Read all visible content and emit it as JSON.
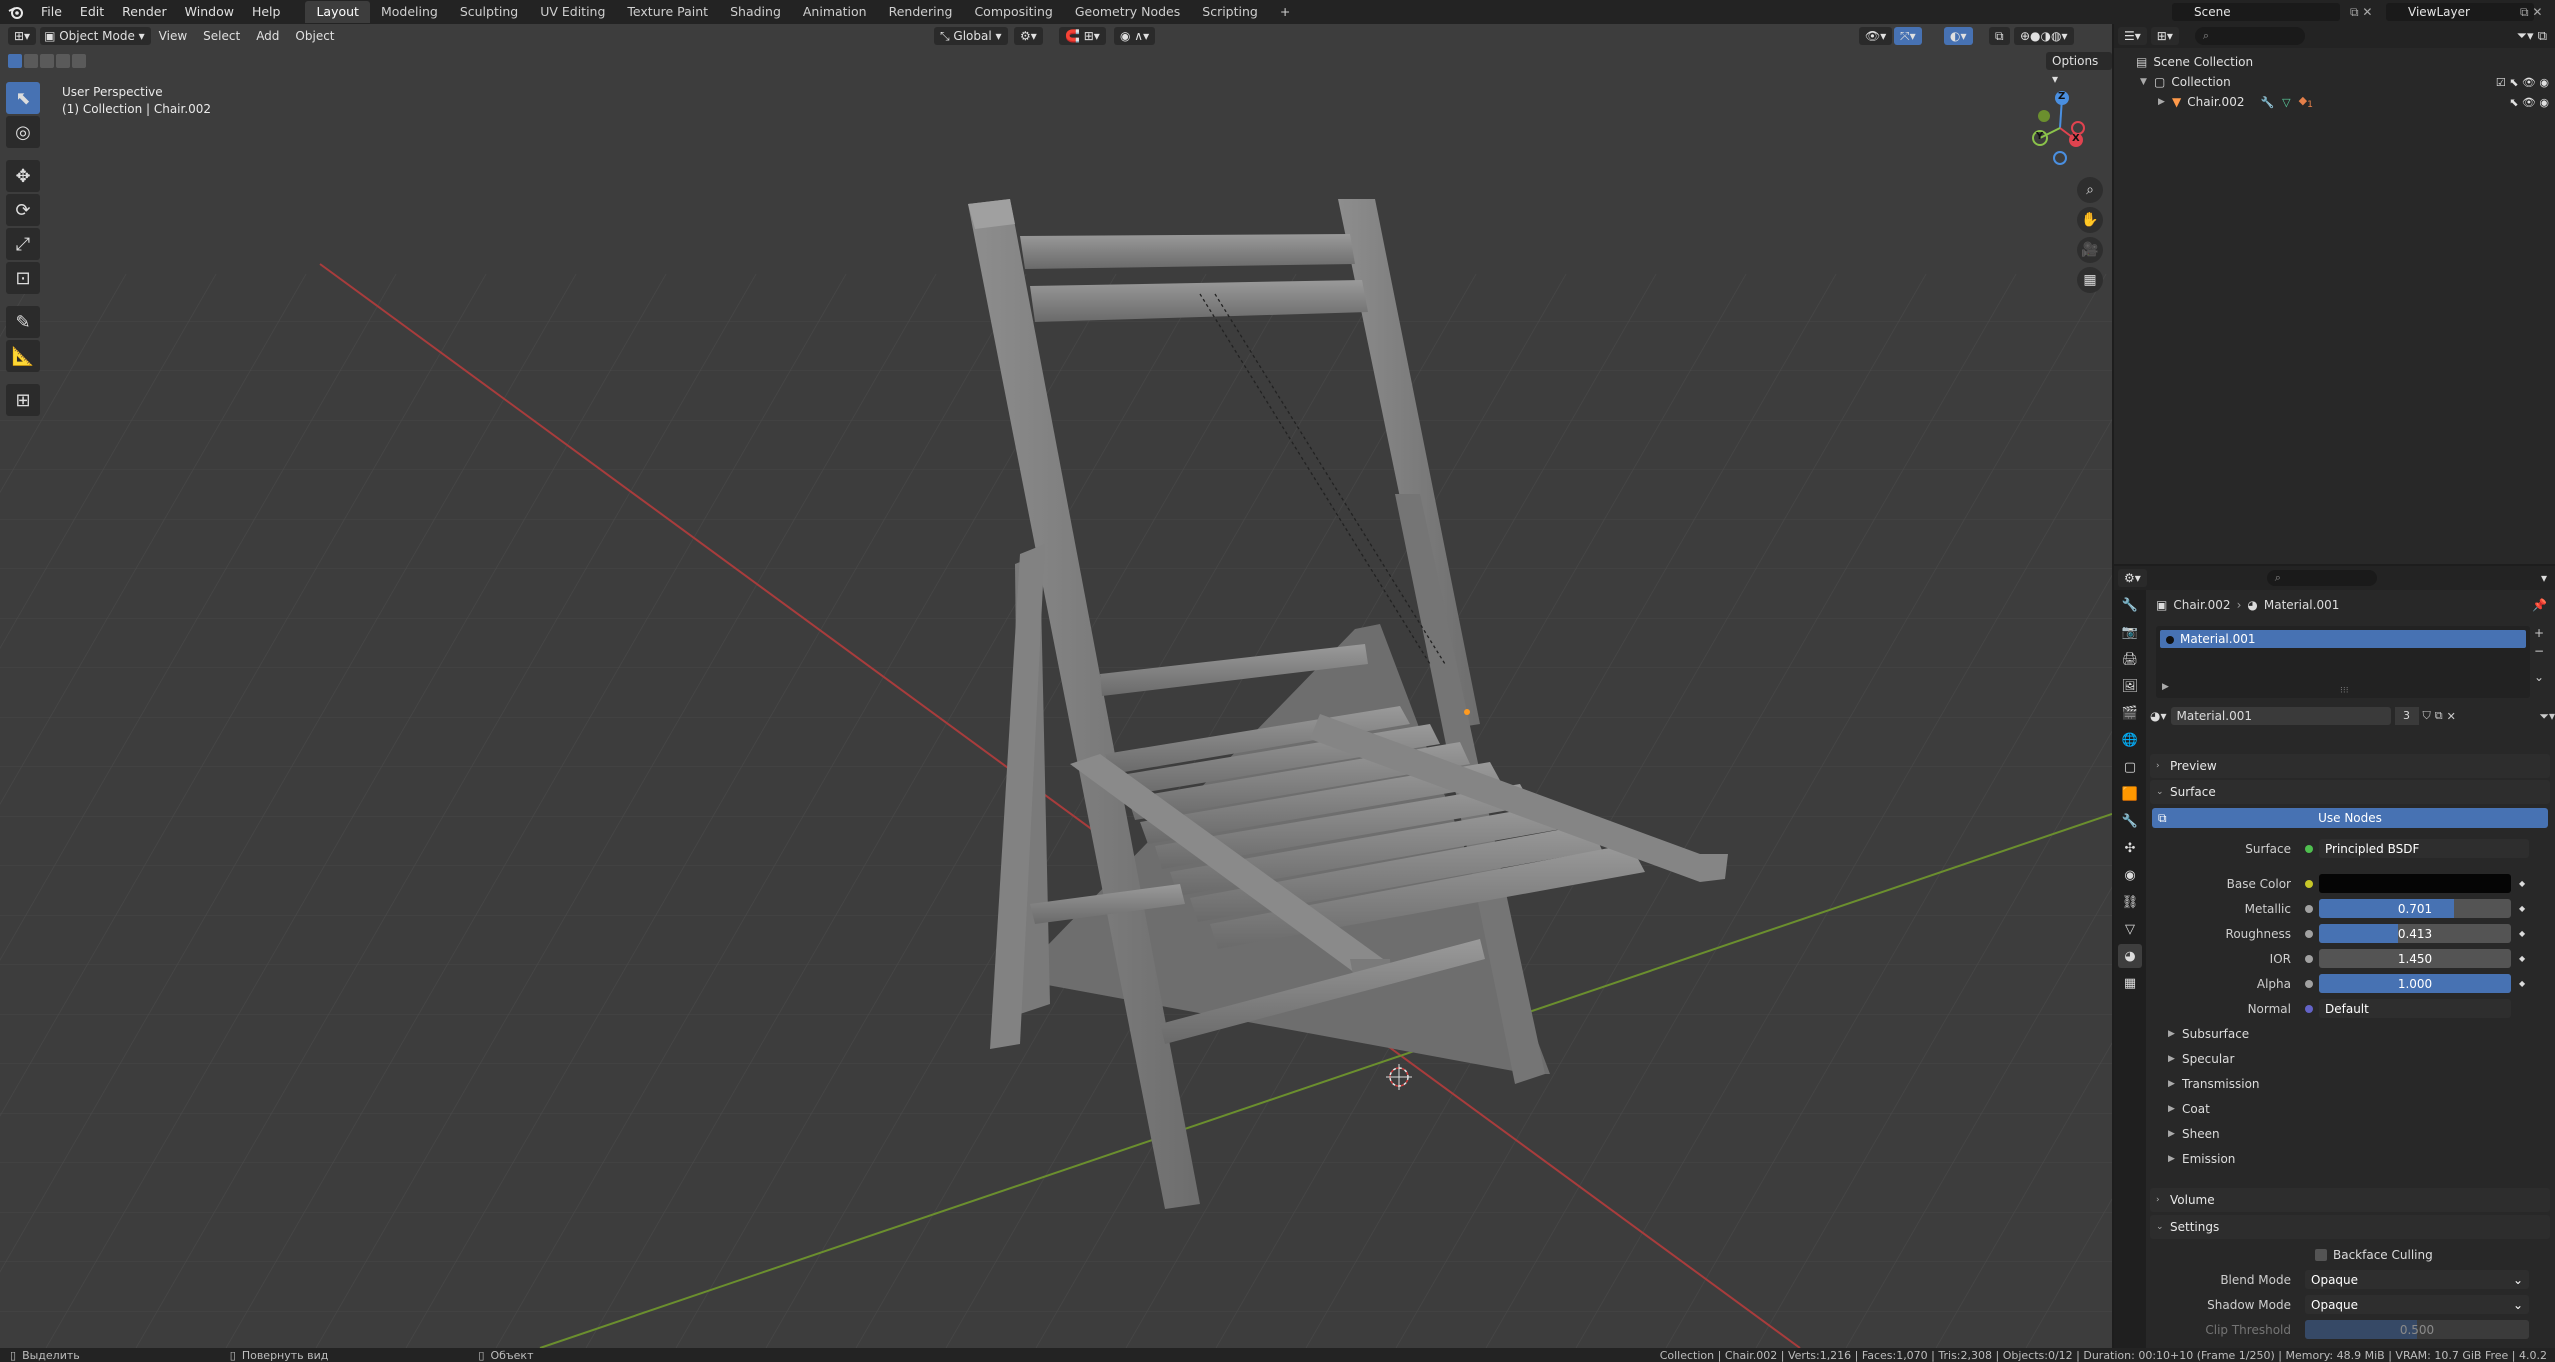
{
  "menu": {
    "file": "File",
    "edit": "Edit",
    "render": "Render",
    "window": "Window",
    "help": "Help"
  },
  "workspaces": [
    "Layout",
    "Modeling",
    "Sculpting",
    "UV Editing",
    "Texture Paint",
    "Shading",
    "Animation",
    "Rendering",
    "Compositing",
    "Geometry Nodes",
    "Scripting"
  ],
  "add_tab": "+",
  "scene": "Scene",
  "view_layer": "ViewLayer",
  "viewport": {
    "mode": "Object Mode",
    "menus": {
      "view": "View",
      "select": "Select",
      "add": "Add",
      "object": "Object"
    },
    "transform": "Global",
    "options": "Options",
    "info_line1": "User Perspective",
    "info_line2": "(1) Collection | Chair.002",
    "gizmo": {
      "z": "Z",
      "x": "X",
      "y": "Y"
    }
  },
  "outliner": {
    "scene_collection": "Scene Collection",
    "collection": "Collection",
    "object": "Chair.002",
    "modifier_count": "1"
  },
  "properties": {
    "breadcrumb_object": "Chair.002",
    "breadcrumb_material": "Material.001",
    "slot_name": "Material.001",
    "material_name": "Material.001",
    "user_count": "3",
    "sections": {
      "preview": "Preview",
      "surface": "Surface",
      "volume": "Volume",
      "settings": "Settings"
    },
    "use_nodes": "Use Nodes",
    "surface_label": "Surface",
    "surface_value": "Principled BSDF",
    "base_color_label": "Base Color",
    "base_color": "#050505",
    "metallic_label": "Metallic",
    "metallic": "0.701",
    "metallic_fraction": 0.701,
    "roughness_label": "Roughness",
    "roughness": "0.413",
    "roughness_fraction": 0.413,
    "ior_label": "IOR",
    "ior": "1.450",
    "alpha_label": "Alpha",
    "alpha": "1.000",
    "alpha_fraction": 1.0,
    "normal_label": "Normal",
    "normal_value": "Default",
    "subpanels": [
      "Subsurface",
      "Specular",
      "Transmission",
      "Coat",
      "Sheen",
      "Emission"
    ],
    "backface_culling": "Backface Culling",
    "blend_mode_label": "Blend Mode",
    "blend_mode": "Opaque",
    "shadow_mode_label": "Shadow Mode",
    "shadow_mode": "Opaque",
    "clip_threshold_label": "Clip Threshold",
    "clip_threshold": "0.500"
  },
  "statusbar": {
    "left1": "Выделить",
    "left2": "Повернуть вид",
    "left3": "Объект",
    "right": "Collection | Chair.002 | Verts:1,216 | Faces:1,070 | Tris:2,308 | Objects:0/12 | Duration: 00:10+10 (Frame 1/250) | Memory: 48.9 MiB | VRAM: 10.7 GiB Free | 4.0.2"
  },
  "colors": {
    "accent": "#4772b3",
    "x_axis": "#e0434f",
    "y_axis": "#8bc34a",
    "z_axis": "#4a8fe0"
  }
}
